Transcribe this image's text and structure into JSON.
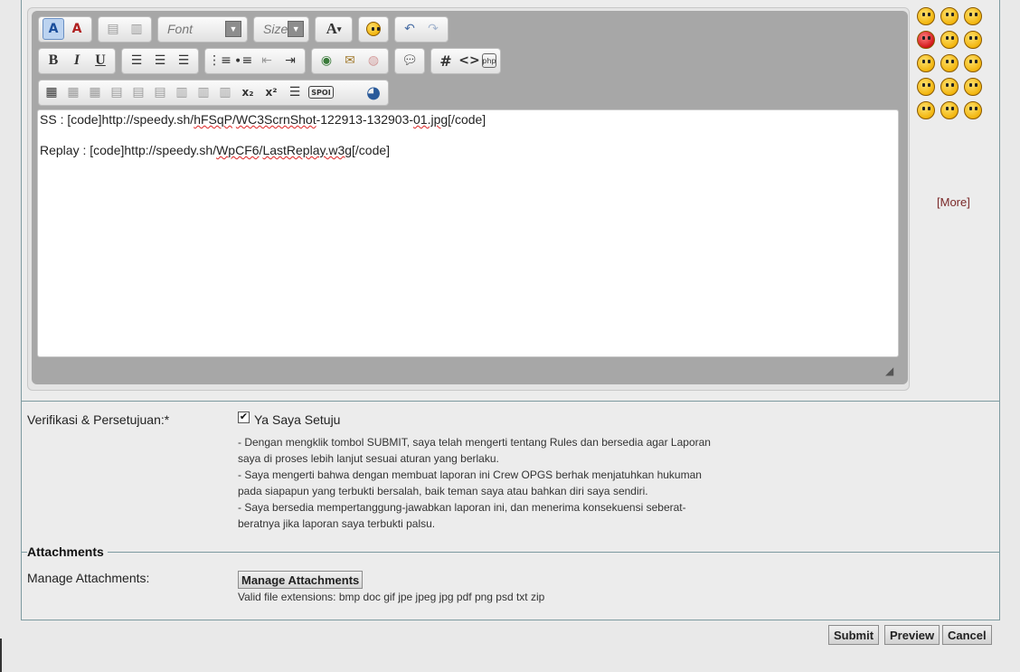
{
  "toolbar": {
    "font_select": "Font",
    "size_select": "Size",
    "font_color_label": "A",
    "bold_label": "B",
    "italic_label": "I",
    "underline_label": "U",
    "hash_label": "#",
    "code_label": "<>",
    "subscript_label": "x₂",
    "superscript_label": "x²",
    "spoiler_label": "SPOI"
  },
  "editor": {
    "line1_prefix": "SS : [code]",
    "line1_link_a": "http://speedy.sh/",
    "line1_link_b": "hFSqP",
    "line1_link_c": "/",
    "line1_link_d": "WC3ScrnShot",
    "line1_link_e": "-122913-132903-",
    "line1_link_f": "01.jpg",
    "line1_suffix": "[/code]",
    "line2_prefix": "Replay : [code]",
    "line2_link_a": "http://speedy.sh/",
    "line2_link_b": "WpCF6",
    "line2_link_c": "/",
    "line2_link_d": "LastReplay.w3g",
    "line2_suffix": "[/code]"
  },
  "smilies": {
    "more_label": "[More]"
  },
  "verification": {
    "label": "Verifikasi & Persetujuan:*",
    "checkbox_label": "Ya Saya Setuju",
    "checked": true,
    "lines": [
      "- Dengan mengklik tombol SUBMIT, saya telah mengerti tentang Rules dan bersedia agar Laporan",
      "saya di proses lebih lanjut sesuai aturan yang berlaku.",
      "- Saya mengerti bahwa dengan membuat laporan ini Crew OPGS berhak menjatuhkan hukuman",
      "pada siapapun yang terbukti bersalah, baik teman saya atau bahkan diri saya sendiri.",
      "- Saya bersedia mempertanggung-jawabkan laporan ini, dan menerima konsekuensi seberat-",
      "beratnya jika laporan saya terbukti palsu."
    ]
  },
  "attachments": {
    "legend": "Attachments",
    "label": "Manage Attachments:",
    "button_label": "Manage Attachments",
    "valid_extensions": "Valid file extensions: bmp doc gif jpe jpeg jpg pdf png psd txt zip"
  },
  "actions": {
    "submit_label": "Submit",
    "preview_label": "Preview",
    "cancel_label": "Cancel"
  }
}
